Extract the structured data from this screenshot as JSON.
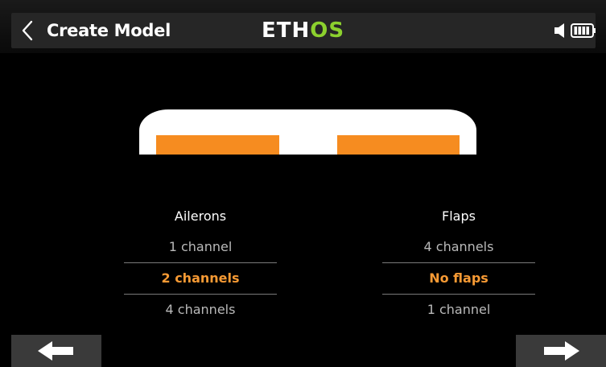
{
  "header": {
    "title": "Create Model",
    "logo": {
      "part1": "ETH",
      "part2": "OS",
      "color_white": "#ffffff",
      "color_green": "#8cd12e"
    },
    "back_icon": "chevron-left-icon",
    "status_icons": [
      "speaker-icon",
      "battery-icon"
    ]
  },
  "diagram": {
    "description_icon": "wing-icon",
    "surface_color": "#f68c20"
  },
  "ailerons": {
    "label": "Ailerons",
    "options": [
      "1 channel",
      "2 channels",
      "4 channels"
    ],
    "selected": "2 channels"
  },
  "flaps": {
    "label": "Flaps",
    "options": [
      "4 channels",
      "No flaps",
      "1 channel"
    ],
    "selected": "No flaps"
  },
  "nav": {
    "prev_icon": "arrow-left-icon",
    "next_icon": "arrow-right-icon"
  },
  "colors": {
    "accent": "#f79a34",
    "background": "#000000",
    "header": "#262626",
    "option_text": "#b9b9b9"
  }
}
